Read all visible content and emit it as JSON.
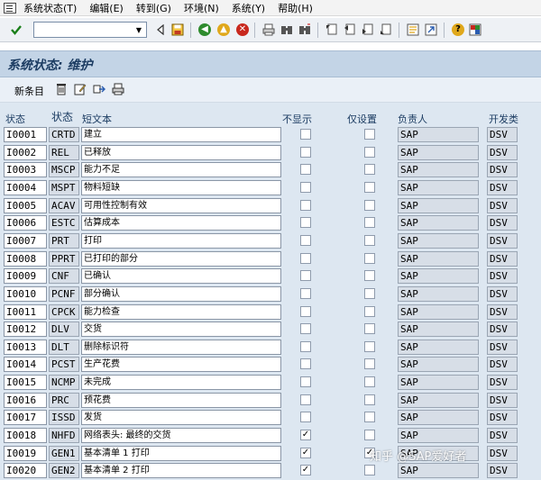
{
  "menu": {
    "items": [
      "系统状态(T)",
      "编辑(E)",
      "转到(G)",
      "环境(N)",
      "系统(Y)",
      "帮助(H)"
    ]
  },
  "toolbar": {
    "command_value": "",
    "icons": [
      "check-icon",
      "back-icon",
      "save-icon",
      "back-green-icon",
      "exit-icon",
      "cancel-icon",
      "print-icon",
      "find-icon",
      "find-next-icon",
      "first-page-icon",
      "prev-page-icon",
      "next-page-icon",
      "last-page-icon",
      "new-session-icon",
      "shortcut-icon",
      "help-icon",
      "layout-icon"
    ]
  },
  "title": "系统状态: 维护",
  "app_toolbar": {
    "new_entries": "新条目",
    "icons": [
      "delete-icon",
      "edit-icon",
      "transport-icon",
      "print-icon"
    ]
  },
  "table": {
    "headers": {
      "status": "状态",
      "code": "状态",
      "short_text": "短文本",
      "no_display": "不显示",
      "maintain_only": "仅设置",
      "owner": "负责人",
      "dev_class": "开发类"
    },
    "rows": [
      {
        "status": "I0001",
        "code": "CRTD",
        "text": "建立",
        "no_display": false,
        "maintain": false,
        "owner": "SAP",
        "dev": "DSV"
      },
      {
        "status": "I0002",
        "code": "REL",
        "text": "已释放",
        "no_display": false,
        "maintain": false,
        "owner": "SAP",
        "dev": "DSV"
      },
      {
        "status": "I0003",
        "code": "MSCP",
        "text": "能力不足",
        "no_display": false,
        "maintain": false,
        "owner": "SAP",
        "dev": "DSV"
      },
      {
        "status": "I0004",
        "code": "MSPT",
        "text": "物料短缺",
        "no_display": false,
        "maintain": false,
        "owner": "SAP",
        "dev": "DSV"
      },
      {
        "status": "I0005",
        "code": "ACAV",
        "text": "可用性控制有效",
        "no_display": false,
        "maintain": false,
        "owner": "SAP",
        "dev": "DSV"
      },
      {
        "status": "I0006",
        "code": "ESTC",
        "text": "估算成本",
        "no_display": false,
        "maintain": false,
        "owner": "SAP",
        "dev": "DSV"
      },
      {
        "status": "I0007",
        "code": "PRT",
        "text": "打印",
        "no_display": false,
        "maintain": false,
        "owner": "SAP",
        "dev": "DSV"
      },
      {
        "status": "I0008",
        "code": "PPRT",
        "text": "已打印的部分",
        "no_display": false,
        "maintain": false,
        "owner": "SAP",
        "dev": "DSV"
      },
      {
        "status": "I0009",
        "code": "CNF",
        "text": "已确认",
        "no_display": false,
        "maintain": false,
        "owner": "SAP",
        "dev": "DSV"
      },
      {
        "status": "I0010",
        "code": "PCNF",
        "text": "部分确认",
        "no_display": false,
        "maintain": false,
        "owner": "SAP",
        "dev": "DSV"
      },
      {
        "status": "I0011",
        "code": "CPCK",
        "text": "能力检查",
        "no_display": false,
        "maintain": false,
        "owner": "SAP",
        "dev": "DSV"
      },
      {
        "status": "I0012",
        "code": "DLV",
        "text": "交货",
        "no_display": false,
        "maintain": false,
        "owner": "SAP",
        "dev": "DSV"
      },
      {
        "status": "I0013",
        "code": "DLT",
        "text": "删除标识符",
        "no_display": false,
        "maintain": false,
        "owner": "SAP",
        "dev": "DSV"
      },
      {
        "status": "I0014",
        "code": "PCST",
        "text": "生产花费",
        "no_display": false,
        "maintain": false,
        "owner": "SAP",
        "dev": "DSV"
      },
      {
        "status": "I0015",
        "code": "NCMP",
        "text": "未完成",
        "no_display": false,
        "maintain": false,
        "owner": "SAP",
        "dev": "DSV"
      },
      {
        "status": "I0016",
        "code": "PRC",
        "text": "预花费",
        "no_display": false,
        "maintain": false,
        "owner": "SAP",
        "dev": "DSV"
      },
      {
        "status": "I0017",
        "code": "ISSD",
        "text": "发货",
        "no_display": false,
        "maintain": false,
        "owner": "SAP",
        "dev": "DSV"
      },
      {
        "status": "I0018",
        "code": "NHFD",
        "text": "网络表头: 最终的交货",
        "no_display": true,
        "maintain": false,
        "owner": "SAP",
        "dev": "DSV"
      },
      {
        "status": "I0019",
        "code": "GEN1",
        "text": "基本清单 1 打印",
        "no_display": true,
        "maintain": true,
        "owner": "SAP",
        "dev": "DSV"
      },
      {
        "status": "I0020",
        "code": "GEN2",
        "text": "基本清单 2 打印",
        "no_display": true,
        "maintain": false,
        "owner": "SAP",
        "dev": "DSV"
      }
    ]
  },
  "watermark": "知乎 @SAP爱好者",
  "colors": {
    "title_bar": "#c3d4e6",
    "table_bg": "#dde7f1",
    "header_text": "#1d3d63"
  }
}
